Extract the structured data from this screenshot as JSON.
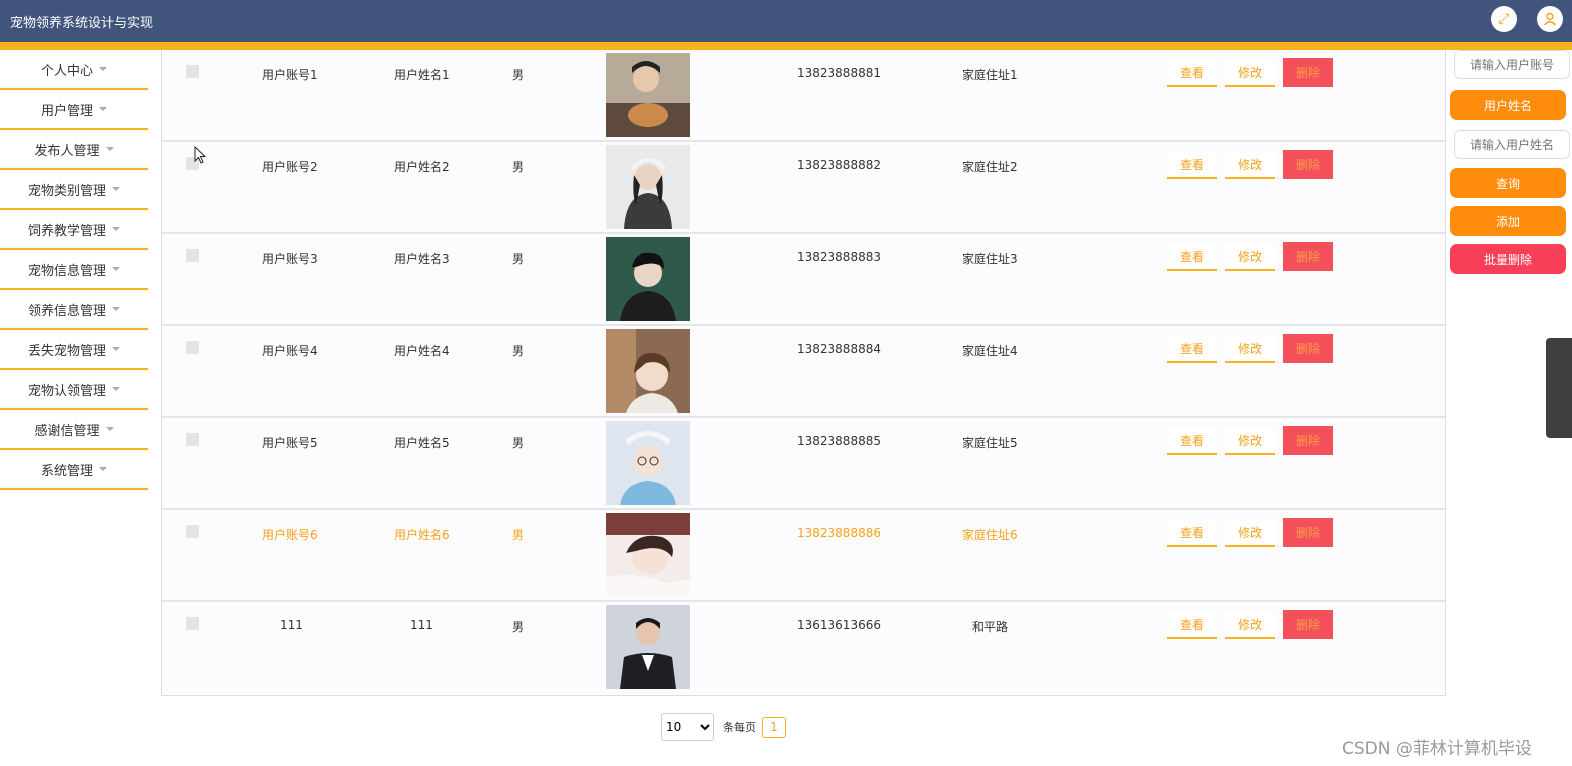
{
  "app": {
    "title": "宠物领养系统设计与实现"
  },
  "header_icons": [
    "fullscreen-icon",
    "user-icon"
  ],
  "sidebar": {
    "items": [
      {
        "label": "个人中心"
      },
      {
        "label": "用户管理"
      },
      {
        "label": "发布人管理"
      },
      {
        "label": "宠物类别管理"
      },
      {
        "label": "饲养教学管理"
      },
      {
        "label": "宠物信息管理"
      },
      {
        "label": "领养信息管理"
      },
      {
        "label": "丢失宠物管理"
      },
      {
        "label": "宠物认领管理"
      },
      {
        "label": "感谢信管理"
      },
      {
        "label": "系统管理"
      }
    ]
  },
  "table": {
    "actions": {
      "view": "查看",
      "edit": "修改",
      "delete": "删除"
    },
    "rows": [
      {
        "account": "用户账号1",
        "name": "用户姓名1",
        "gender": "男",
        "phone": "13823888881",
        "address": "家庭住址1"
      },
      {
        "account": "用户账号2",
        "name": "用户姓名2",
        "gender": "男",
        "phone": "13823888882",
        "address": "家庭住址2"
      },
      {
        "account": "用户账号3",
        "name": "用户姓名3",
        "gender": "男",
        "phone": "13823888883",
        "address": "家庭住址3"
      },
      {
        "account": "用户账号4",
        "name": "用户姓名4",
        "gender": "男",
        "phone": "13823888884",
        "address": "家庭住址4"
      },
      {
        "account": "用户账号5",
        "name": "用户姓名5",
        "gender": "男",
        "phone": "13823888885",
        "address": "家庭住址5"
      },
      {
        "account": "用户账号6",
        "name": "用户姓名6",
        "gender": "男",
        "phone": "13823888886",
        "address": "家庭住址6"
      },
      {
        "account": "111",
        "name": "111",
        "gender": "男",
        "phone": "13613613666",
        "address": "和平路"
      }
    ]
  },
  "search": {
    "account_placeholder": "请输入用户账号",
    "name_label": "用户姓名",
    "name_placeholder": "请输入用户姓名",
    "query_label": "查询",
    "add_label": "添加",
    "batch_delete_label": "批量删除"
  },
  "pagination": {
    "page_size": "10",
    "page_size_label": "条每页",
    "current_page": "1"
  },
  "colors": {
    "header": "#40547c",
    "accent": "#f7b31b",
    "orange": "#ff8c0a",
    "red": "#f73f58"
  },
  "watermark": "CSDN @菲林计算机毕设"
}
